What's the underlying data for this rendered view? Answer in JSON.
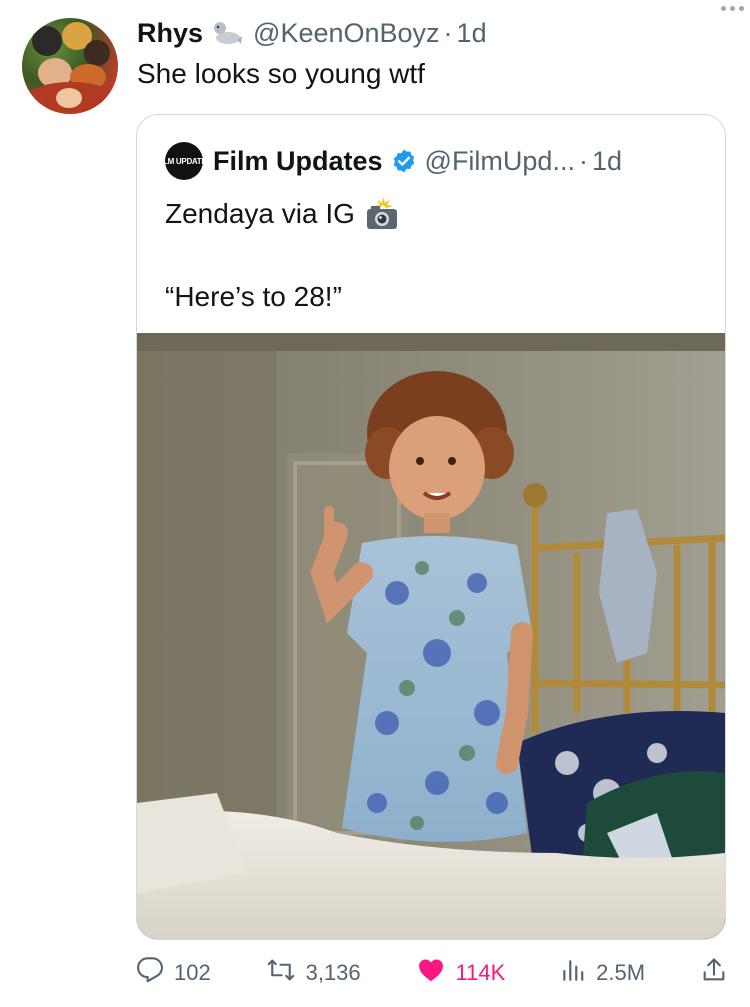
{
  "tweet": {
    "author_name": "Rhys",
    "author_handle": "@KeenOnBoyz",
    "separator": "·",
    "time": "1d",
    "text": "She looks so young wtf"
  },
  "quoted_tweet": {
    "logo_text": "FILM UPDATES",
    "author_name": "Film Updates",
    "author_handle": "@FilmUpd...",
    "separator": "·",
    "time": "1d",
    "line1": "Zendaya via IG",
    "line2": "“Here’s to 28!”"
  },
  "actions": {
    "replies": "102",
    "retweets": "3,136",
    "likes": "114K",
    "views": "2.5M"
  },
  "colors": {
    "text": "#0f1419",
    "secondary": "#536471",
    "like": "#f91880",
    "verified": "#1d9bf0",
    "border": "#cfd9de"
  },
  "icons": [
    "seal-emoji-icon",
    "more-icon",
    "verified-badge-icon",
    "camera-flash-emoji-icon",
    "reply-icon",
    "retweet-icon",
    "like-icon",
    "views-icon",
    "share-icon"
  ]
}
